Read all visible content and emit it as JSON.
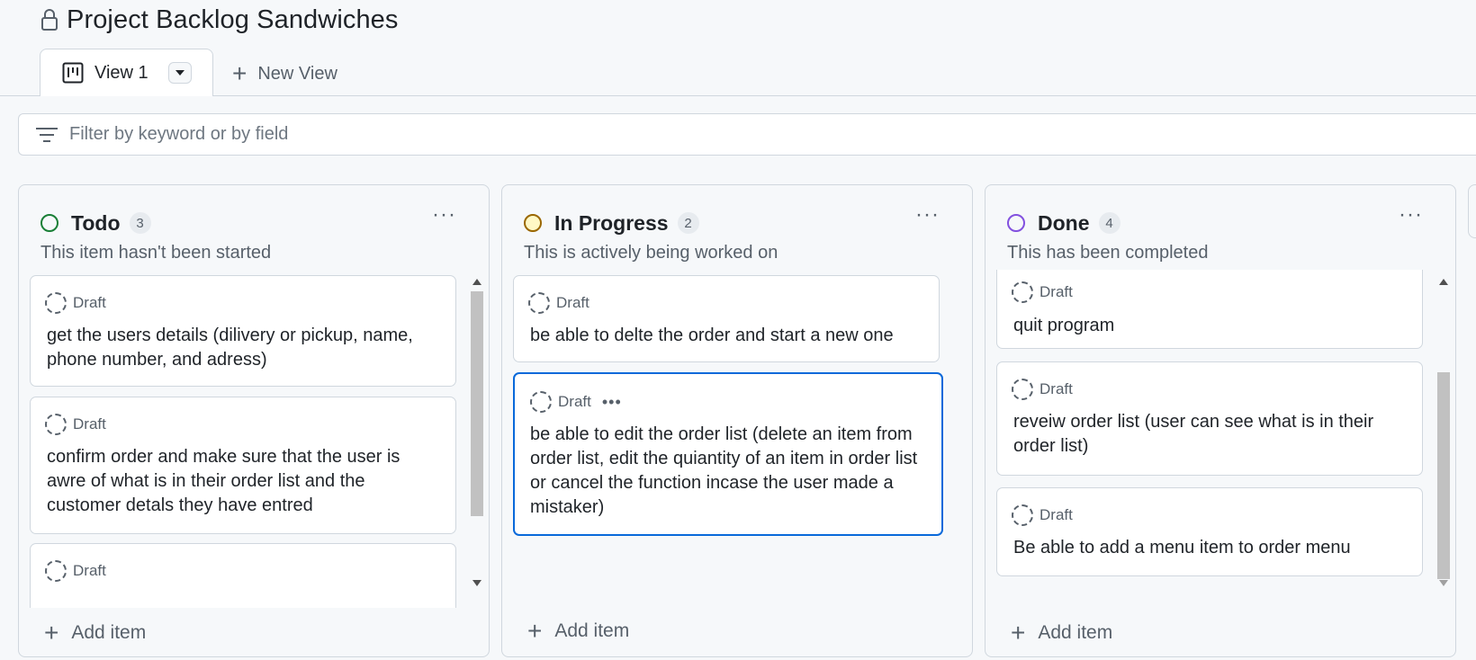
{
  "project": {
    "title": "Project Backlog Sandwiches",
    "icon": "lock-icon"
  },
  "tabs": {
    "active": {
      "label": "View 1",
      "icon": "board-icon"
    },
    "new_view_label": "New View"
  },
  "filter": {
    "placeholder": "Filter by keyword or by field"
  },
  "columns": [
    {
      "name": "Todo",
      "count": "3",
      "description": "This item hasn't been started",
      "status_color": "#1a7f37",
      "add_item_label": "Add item",
      "cards": [
        {
          "status": "Draft",
          "text": "get the users details (dilivery or pickup, name, phone number, and adress)"
        },
        {
          "status": "Draft",
          "text": "confirm order and make sure that the user is awre of what is in their order list and the customer detals they have entred"
        },
        {
          "status": "Draft",
          "text": ""
        }
      ]
    },
    {
      "name": "In Progress",
      "count": "2",
      "description": "This is actively being worked on",
      "status_color": "#9a6700",
      "status_fill": "#fff8c5",
      "add_item_label": "Add item",
      "cards": [
        {
          "status": "Draft",
          "text": "be able to delte the order and start a new one"
        },
        {
          "status": "Draft",
          "text": "be able to edit the order list (delete an item from order list, edit the quiantity of an item in order list or cancel the function incase the user made a mistaker)",
          "menu": "•••"
        }
      ]
    },
    {
      "name": "Done",
      "count": "4",
      "description": "This has been completed",
      "status_color": "#8250df",
      "add_item_label": "Add item",
      "cards": [
        {
          "status": "Draft",
          "text": "quit program"
        },
        {
          "status": "Draft",
          "text": "reveiw order list (user can see what is in their order list)"
        },
        {
          "status": "Draft",
          "text": "Be able to add a menu item to order menu"
        }
      ]
    }
  ],
  "column_menu_label": "···",
  "accent_color": "#0969da"
}
